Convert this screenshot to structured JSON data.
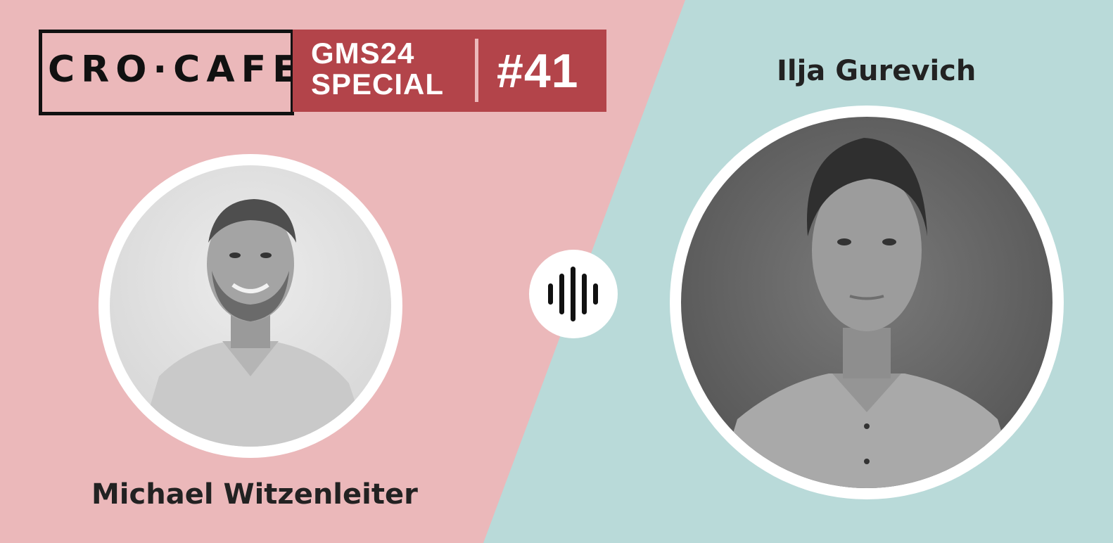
{
  "logo": {
    "text": "CRO·CAFE"
  },
  "banner": {
    "line1": "GMS24",
    "line2": "SPECIAL",
    "episode": "#41"
  },
  "guests": [
    {
      "name": "Michael Witzenleiter",
      "photo_icon": "person-portrait-icon"
    },
    {
      "name": "Ilja Gurevich",
      "photo_icon": "person-portrait-icon"
    }
  ],
  "colors": {
    "pink": "#ebb8ba",
    "teal": "#b9dad9",
    "banner": "#b3444a",
    "text": "#222222"
  },
  "center_icon": "sound-wave-icon"
}
